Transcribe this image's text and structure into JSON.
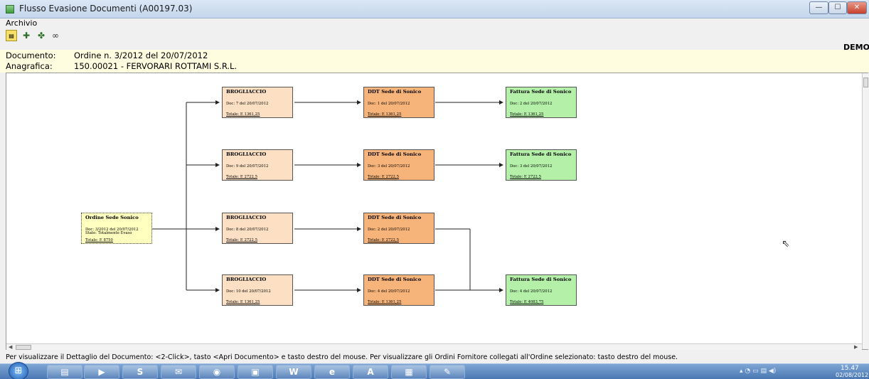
{
  "window": {
    "title": "Flusso Evasione Documenti (A00197.03)",
    "buttons": {
      "minimize": "—",
      "maximize": "☐",
      "close": "✕"
    }
  },
  "menu": {
    "items": [
      "Archivio"
    ]
  },
  "toolbar": {
    "icons": [
      "document-icon",
      "users-add-icon",
      "users-icon",
      "binoculars-icon"
    ]
  },
  "demo_label": "DEMO",
  "header": {
    "documento_label": "Documento:",
    "documento_value": "Ordine n. 3/2012 del 20/07/2012",
    "anagrafica_label": "Anagrafica:",
    "anagrafica_value": "150.00021 - FERVORARI ROTTAMI S.R.L."
  },
  "nodes": {
    "order": {
      "title": "Ordine Sede Sonico",
      "doc": "Doc: 3/2012 del 20/07/2012",
      "stato": "Stato: Totalmente Evaso",
      "totale": "Totale: E  8750"
    },
    "brog": [
      {
        "title": "BROGLIACCIO",
        "doc": "Doc: 7 del 20/07/2012",
        "totale": "Totale: E  1361,25"
      },
      {
        "title": "BROGLIACCIO",
        "doc": "Doc: 9 del 20/07/2012",
        "totale": "Totale: E  2722,5"
      },
      {
        "title": "BROGLIACCIO",
        "doc": "Doc: 8 del 20/07/2012",
        "totale": "Totale: E  2722,5"
      },
      {
        "title": "BROGLIACCIO",
        "doc": "Doc: 10 del 20/07/2012",
        "totale": "Totale: E  1361,25"
      }
    ],
    "ddt": [
      {
        "title": "DDT Sede di Sonico",
        "doc": "Doc: 1 del 20/07/2012",
        "totale": "Totale: E  1361,25"
      },
      {
        "title": "DDT Sede di Sonico",
        "doc": "Doc: 3 del 20/07/2012",
        "totale": "Totale: E  2722,5"
      },
      {
        "title": "DDT Sede di Sonico",
        "doc": "Doc: 2 del 20/07/2012",
        "totale": "Totale: E  2722,5"
      },
      {
        "title": "DDT Sede di Sonico",
        "doc": "Doc: 4 del 20/07/2012",
        "totale": "Totale: E  1361,25"
      }
    ],
    "fatt": [
      {
        "title": "Fattura Sede di Sonico",
        "doc": "Doc: 2 del 20/07/2012",
        "totale": "Totale: E  1361,25"
      },
      {
        "title": "Fattura Sede di Sonico",
        "doc": "Doc: 3 del 20/07/2012",
        "totale": "Totale: E  2722,5"
      },
      {
        "title": "Fattura Sede di Sonico",
        "doc": "Doc: 4 del 20/07/2012",
        "totale": "Totale: E  4083,75"
      }
    ]
  },
  "status_text": "Per visualizzare il Dettaglio del Documento: <2-Click>, tasto <Apri Documento> e tasto destro del mouse. Per visualizzare gli Ordini Fornitore collegati all'Ordine selezionato: tasto destro del mouse.",
  "taskbar": {
    "start_glyph": "⊞",
    "apps": [
      {
        "name": "explorer",
        "glyph": "▤"
      },
      {
        "name": "media-player",
        "glyph": "▶"
      },
      {
        "name": "skype",
        "glyph": "S"
      },
      {
        "name": "outlook",
        "glyph": "✉"
      },
      {
        "name": "settings",
        "glyph": "◉"
      },
      {
        "name": "remote-desktop",
        "glyph": "▣"
      },
      {
        "name": "word",
        "glyph": "W"
      },
      {
        "name": "internet-explorer",
        "glyph": "e"
      },
      {
        "name": "acrobat",
        "glyph": "A"
      },
      {
        "name": "calculator",
        "glyph": "▦"
      },
      {
        "name": "paint",
        "glyph": "✎"
      }
    ],
    "tray": "▴  ◔  ▭  ▤  ◀)",
    "time": "15.47",
    "date": "02/08/2012"
  }
}
